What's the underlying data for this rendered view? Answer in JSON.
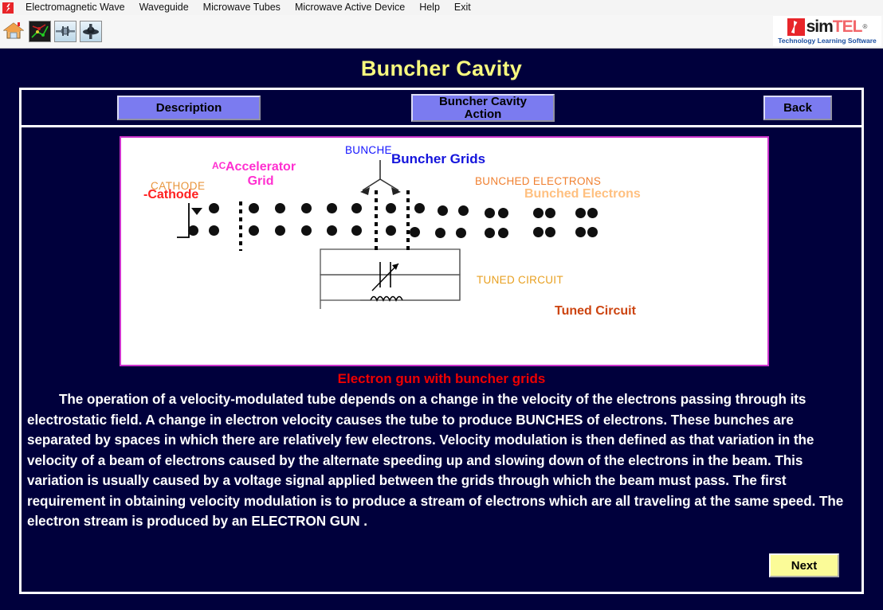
{
  "menubar": {
    "app_icon": "simtel-logo-icon",
    "items": [
      {
        "label": "Electromagnetic Wave",
        "name": "menu-electromagnetic-wave"
      },
      {
        "label": "Waveguide",
        "name": "menu-waveguide"
      },
      {
        "label": "Microwave Tubes",
        "name": "menu-microwave-tubes"
      },
      {
        "label": "Microwave Active Device",
        "name": "menu-microwave-active-device"
      },
      {
        "label": "Help",
        "name": "menu-help"
      },
      {
        "label": "Exit",
        "name": "menu-exit"
      }
    ]
  },
  "toolbar": {
    "buttons": [
      {
        "name": "home-icon",
        "title": "Home"
      },
      {
        "name": "circuit-diagram-icon",
        "title": "Diagram"
      },
      {
        "name": "waveguide-icon",
        "title": "Waveguide"
      },
      {
        "name": "tube-icon",
        "title": "Microwave Tube"
      }
    ]
  },
  "brand": {
    "sim": "sim",
    "tel": "TEL",
    "registered": "®",
    "tagline": "Technology Learning Software"
  },
  "header": {
    "title": "Buncher Cavity"
  },
  "nav": {
    "description_label": "Description",
    "action_label_line1": "Buncher Cavity",
    "action_label_line2": "Action",
    "back_label": "Back"
  },
  "diagram": {
    "cathode_back_label": "CATHODE",
    "cathode_label": "-Cathode",
    "ac_label": "AC",
    "accelerator_label_line1": "Accelerator",
    "accelerator_label_line2": "Grid",
    "buncher_back_label": "BUNCHE",
    "buncher_grids_label": "Buncher Grids",
    "bunched_electrons_back_label": "BUNCHED ELECTRONS",
    "bunched_electrons_label": "Bunched Electrons",
    "tuned_circuit_back_label": "TUNED CIRCUIT",
    "tuned_circuit_label": "Tuned Circuit"
  },
  "caption": "Electron gun with buncher grids",
  "body": {
    "indent_marker": "",
    "paragraph": "The operation of a velocity-modulated tube depends on a change in the velocity of the electrons passing through its electrostatic field. A change in electron velocity causes the tube to produce BUNCHES of electrons. These bunches are separated by spaces in which there are relatively few electrons. Velocity modulation is then defined as that variation in the velocity of a beam of electrons caused by the alternate speeding up and slowing down of the electrons in the beam. This variation is usually caused by a voltage signal applied between the grids through which the beam must pass. The first requirement in obtaining velocity modulation is to produce a stream of electrons which are all traveling at the same speed. The electron stream is produced by an ELECTRON GUN ."
  },
  "footer": {
    "next_label": "Next"
  },
  "colors": {
    "page_background": "#00003c",
    "title_yellow": "#f7f97e",
    "button_purple": "#7b7bf0",
    "next_yellow": "#fbfb98",
    "caption_red": "#ee0000",
    "diagram_border_magenta": "#cc33cc",
    "cathode_red": "#ff2020",
    "accelerator_magenta": "#ff2fd0",
    "buncher_blue": "#1414dc",
    "bunched_peach": "#ffc080",
    "tuned_orange": "#cc4410"
  }
}
